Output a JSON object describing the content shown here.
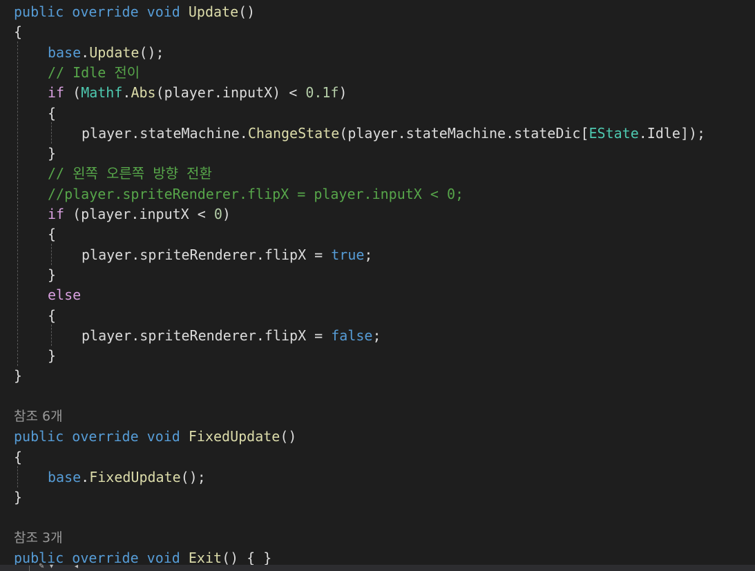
{
  "theme": {
    "background": "#1e1e1e",
    "default": "#dcdcdc",
    "keyword": "#569cd6",
    "control": "#d8a0df",
    "method": "#dcdcaa",
    "type": "#4ec9b0",
    "number": "#b5cea8",
    "comment": "#57a64a",
    "codelens": "#999999",
    "guide": "#5a5a5a"
  },
  "code_lines": [
    {
      "kind": "code",
      "indent": 0,
      "tokens": [
        {
          "t": "public",
          "c": "keyword"
        },
        {
          "t": " "
        },
        {
          "t": "override",
          "c": "keyword"
        },
        {
          "t": " "
        },
        {
          "t": "void",
          "c": "keyword"
        },
        {
          "t": " "
        },
        {
          "t": "Update",
          "c": "method"
        },
        {
          "t": "()"
        }
      ]
    },
    {
      "kind": "code",
      "indent": 0,
      "tokens": [
        {
          "t": "{"
        }
      ]
    },
    {
      "kind": "code",
      "indent": 1,
      "tokens": [
        {
          "t": "base",
          "c": "keyword"
        },
        {
          "t": "."
        },
        {
          "t": "Update",
          "c": "method"
        },
        {
          "t": "();"
        }
      ]
    },
    {
      "kind": "code",
      "indent": 1,
      "tokens": [
        {
          "t": "// Idle 전이",
          "c": "comment"
        }
      ]
    },
    {
      "kind": "code",
      "indent": 1,
      "tokens": [
        {
          "t": "if",
          "c": "control"
        },
        {
          "t": " ("
        },
        {
          "t": "Mathf",
          "c": "type"
        },
        {
          "t": "."
        },
        {
          "t": "Abs",
          "c": "method"
        },
        {
          "t": "(player.inputX) < "
        },
        {
          "t": "0.1f",
          "c": "number"
        },
        {
          "t": ")"
        }
      ]
    },
    {
      "kind": "code",
      "indent": 1,
      "tokens": [
        {
          "t": "{"
        }
      ]
    },
    {
      "kind": "code",
      "indent": 2,
      "tokens": [
        {
          "t": "player.stateMachine."
        },
        {
          "t": "ChangeState",
          "c": "method"
        },
        {
          "t": "(player.stateMachine.stateDic["
        },
        {
          "t": "EState",
          "c": "type"
        },
        {
          "t": ".Idle]);"
        }
      ]
    },
    {
      "kind": "code",
      "indent": 1,
      "tokens": [
        {
          "t": "}"
        }
      ]
    },
    {
      "kind": "code",
      "indent": 1,
      "tokens": [
        {
          "t": "// 왼쪽 오른쪽 방향 전환",
          "c": "comment"
        }
      ]
    },
    {
      "kind": "code",
      "indent": 1,
      "tokens": [
        {
          "t": "//player.spriteRenderer.flipX = player.inputX < 0;",
          "c": "comment"
        }
      ]
    },
    {
      "kind": "code",
      "indent": 1,
      "tokens": [
        {
          "t": "if",
          "c": "control"
        },
        {
          "t": " (player.inputX < "
        },
        {
          "t": "0",
          "c": "number"
        },
        {
          "t": ")"
        }
      ]
    },
    {
      "kind": "code",
      "indent": 1,
      "tokens": [
        {
          "t": "{"
        }
      ]
    },
    {
      "kind": "code",
      "indent": 2,
      "tokens": [
        {
          "t": "player.spriteRenderer.flipX = "
        },
        {
          "t": "true",
          "c": "keyword"
        },
        {
          "t": ";"
        }
      ]
    },
    {
      "kind": "code",
      "indent": 1,
      "tokens": [
        {
          "t": "}"
        }
      ]
    },
    {
      "kind": "code",
      "indent": 1,
      "tokens": [
        {
          "t": "else",
          "c": "control"
        }
      ]
    },
    {
      "kind": "code",
      "indent": 1,
      "tokens": [
        {
          "t": "{"
        }
      ]
    },
    {
      "kind": "code",
      "indent": 2,
      "tokens": [
        {
          "t": "player.spriteRenderer.flipX = "
        },
        {
          "t": "false",
          "c": "keyword"
        },
        {
          "t": ";"
        }
      ]
    },
    {
      "kind": "code",
      "indent": 1,
      "tokens": [
        {
          "t": "}"
        }
      ]
    },
    {
      "kind": "code",
      "indent": 0,
      "tokens": [
        {
          "t": "}"
        }
      ]
    },
    {
      "kind": "blank",
      "indent": 0,
      "tokens": []
    },
    {
      "kind": "codelens",
      "indent": 0,
      "tokens": [
        {
          "t": "참조 6개",
          "c": "codelens"
        }
      ]
    },
    {
      "kind": "code",
      "indent": 0,
      "tokens": [
        {
          "t": "public",
          "c": "keyword"
        },
        {
          "t": " "
        },
        {
          "t": "override",
          "c": "keyword"
        },
        {
          "t": " "
        },
        {
          "t": "void",
          "c": "keyword"
        },
        {
          "t": " "
        },
        {
          "t": "FixedUpdate",
          "c": "method"
        },
        {
          "t": "()"
        }
      ]
    },
    {
      "kind": "code",
      "indent": 0,
      "tokens": [
        {
          "t": "{"
        }
      ]
    },
    {
      "kind": "code",
      "indent": 1,
      "tokens": [
        {
          "t": "base",
          "c": "keyword"
        },
        {
          "t": "."
        },
        {
          "t": "FixedUpdate",
          "c": "method"
        },
        {
          "t": "();"
        }
      ]
    },
    {
      "kind": "code",
      "indent": 0,
      "tokens": [
        {
          "t": "}"
        }
      ]
    },
    {
      "kind": "blank",
      "indent": 0,
      "tokens": []
    },
    {
      "kind": "codelens",
      "indent": 0,
      "tokens": [
        {
          "t": "참조 3개",
          "c": "codelens"
        }
      ]
    },
    {
      "kind": "code",
      "indent": 0,
      "tokens": [
        {
          "t": "public",
          "c": "keyword"
        },
        {
          "t": " "
        },
        {
          "t": "override",
          "c": "keyword"
        },
        {
          "t": " "
        },
        {
          "t": "void",
          "c": "keyword"
        },
        {
          "t": " "
        },
        {
          "t": "Exit",
          "c": "method"
        },
        {
          "t": "() { }"
        }
      ]
    }
  ],
  "status_strip": {
    "icon_names": [
      "wrench-icon",
      "chevron-down-icon",
      "scroll-left-icon"
    ]
  }
}
